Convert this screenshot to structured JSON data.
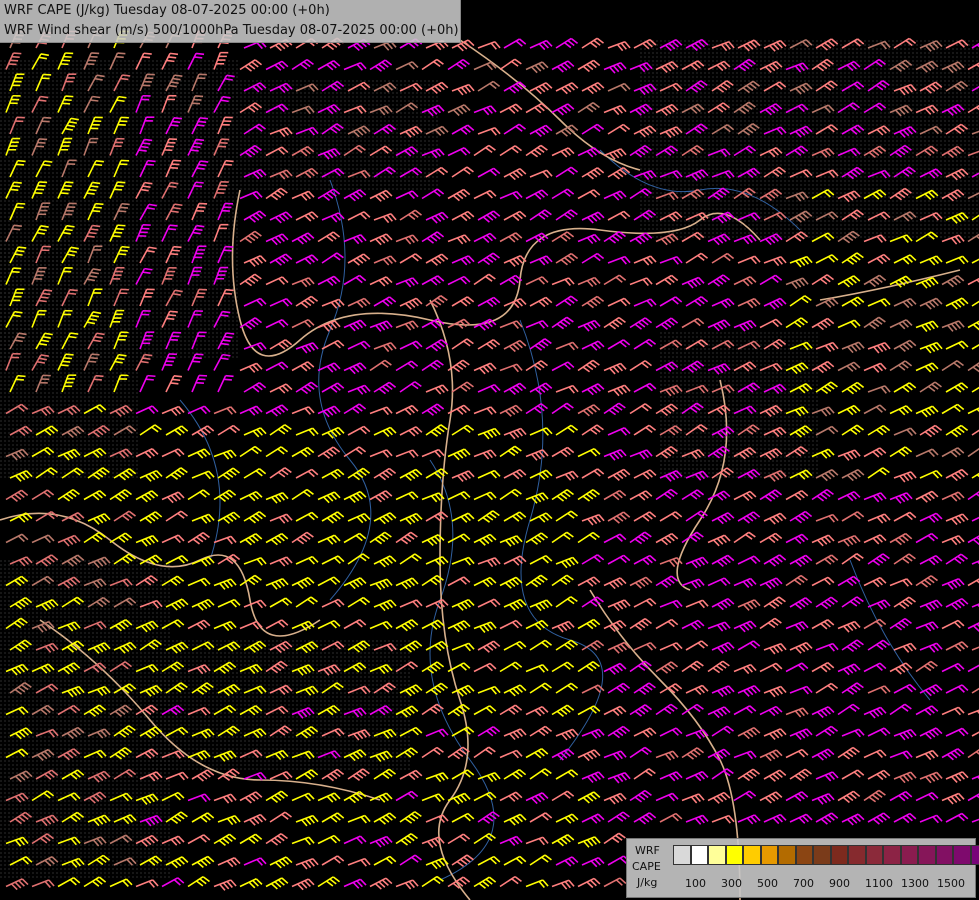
{
  "header": {
    "line1": "WRF CAPE (J/kg) Tuesday 08-07-2025 00:00 (+0h)",
    "line2": "WRF Wind shear (m/s) 500/1000hPa Tuesday 08-07-2025 00:00 (+0h)"
  },
  "legend": {
    "label_model": "WRF",
    "label_field": "CAPE",
    "label_unit": "J/kg",
    "colors": [
      "#d9d9d9",
      "#ffffff",
      "#ffff99",
      "#ffff00",
      "#ffcc00",
      "#e69900",
      "#b36b00",
      "#8b4513",
      "#7a3b1a",
      "#7d2a1e",
      "#862a2e",
      "#8b2a3a",
      "#8c2345",
      "#8a1c4f",
      "#861659",
      "#821063",
      "#7e0a6d",
      "#780478"
    ],
    "ticks": [
      "100",
      "300",
      "500",
      "700",
      "900",
      "1100",
      "1300",
      "1500"
    ]
  },
  "map": {
    "barb_colors": {
      "yellow": "#ffff00",
      "salmon": "#ff7f7f",
      "pink": "#e07070",
      "magenta": "#ee00ee",
      "brown": "#b8786a"
    },
    "border_color": "#d8b08c",
    "river_color": "#3060a0",
    "land_dot_color": "#666666",
    "background": "#000000"
  }
}
